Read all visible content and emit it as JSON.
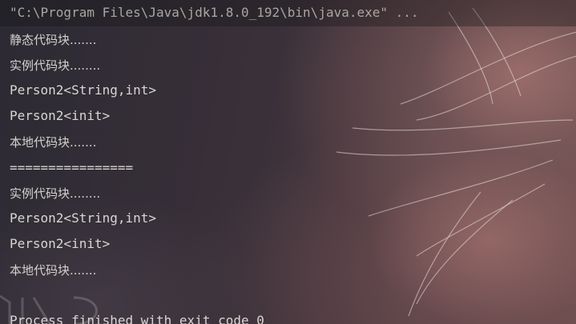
{
  "console": {
    "command_line": "\"C:\\Program Files\\Java\\jdk1.8.0_192\\bin\\java.exe\" ...",
    "output_lines": [
      "静态代码块.......",
      "实例代码块........",
      "Person2<String,int>",
      "Person2<init>",
      "本地代码块.......",
      "================",
      "实例代码块........",
      "Person2<String,int>",
      "Person2<init>",
      "本地代码块......."
    ],
    "process_status": "Process finished with exit code 0"
  }
}
